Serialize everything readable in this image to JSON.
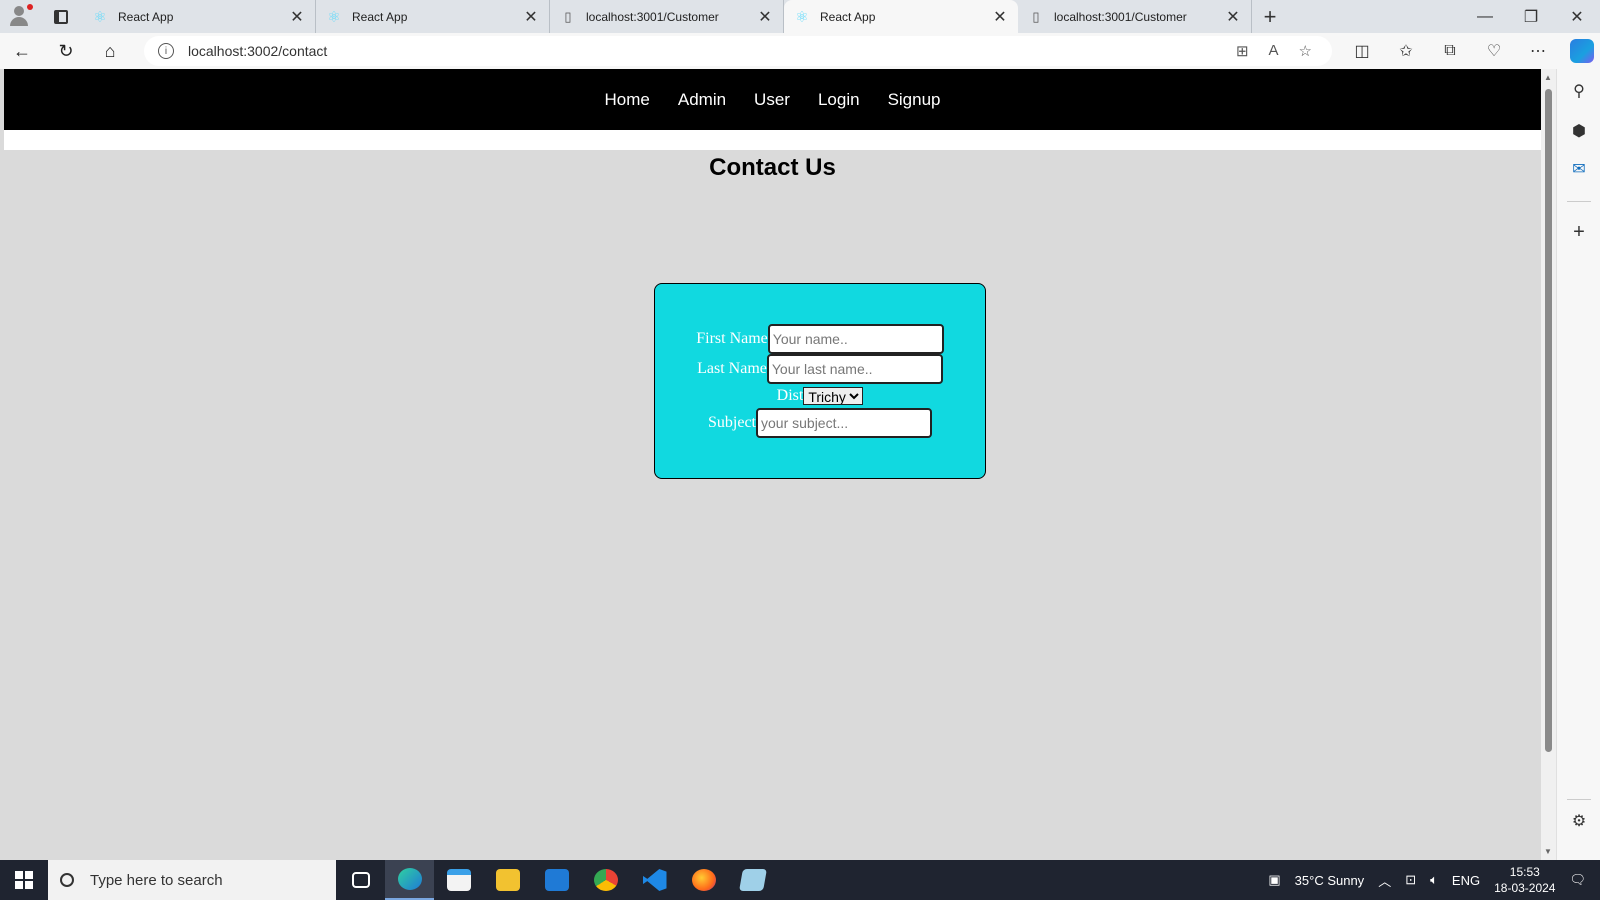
{
  "browser": {
    "tabs": [
      {
        "title": "React App",
        "favicon": "react-icon"
      },
      {
        "title": "React App",
        "favicon": "react-icon"
      },
      {
        "title": "localhost:3001/Customer",
        "favicon": "page-icon"
      },
      {
        "title": "React App",
        "favicon": "react-icon",
        "active": true
      },
      {
        "title": "localhost:3001/Customer",
        "favicon": "page-icon"
      }
    ],
    "url": "localhost:3002/contact"
  },
  "nav": {
    "items": [
      "Home",
      "Admin",
      "User",
      "Login",
      "Signup"
    ]
  },
  "page": {
    "title": "Contact Us"
  },
  "form": {
    "first_name_label": "First Name",
    "first_name_placeholder": "Your name..",
    "last_name_label": "Last Name",
    "last_name_placeholder": "Your last name..",
    "dist_label": "Dist",
    "dist_selected": "Trichy",
    "subject_label": "Subject",
    "subject_placeholder": "your subject..."
  },
  "taskbar": {
    "search_placeholder": "Type here to search",
    "weather": "35°C  Sunny",
    "language": "ENG",
    "time": "15:53",
    "date": "18-03-2024"
  },
  "colors": {
    "navbar": "#000000",
    "page_bg": "#dadada",
    "card_bg": "#11d9e0"
  }
}
